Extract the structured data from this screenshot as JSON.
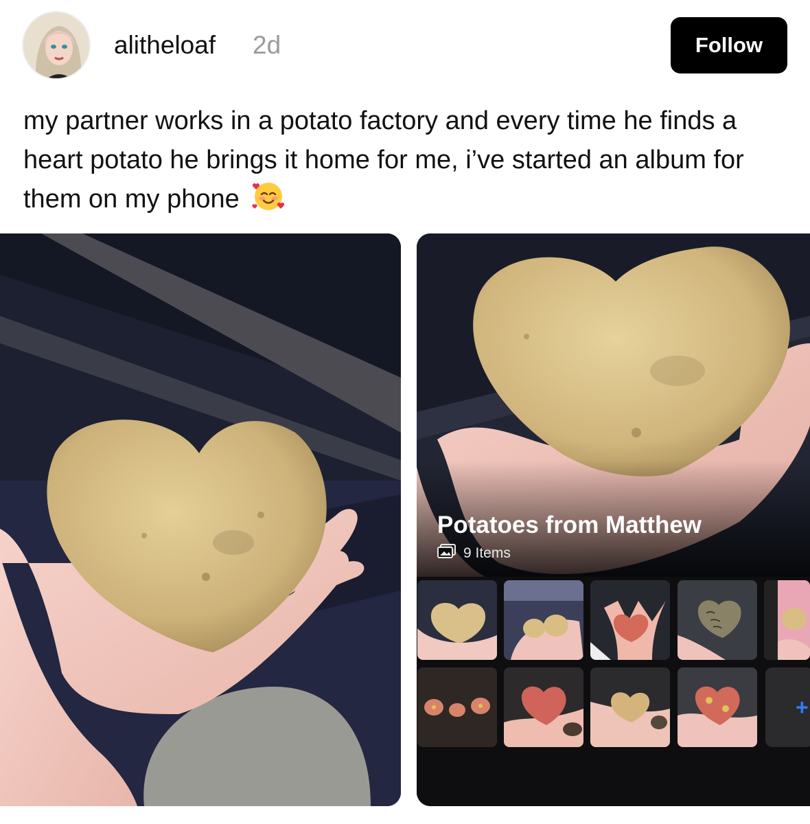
{
  "post": {
    "username": "alitheloaf",
    "timeago": "2d",
    "follow_label": "Follow",
    "caption": "my partner works in a potato factory and every time he finds a heart potato he brings it home for me, i’ve started an album for them on my phone",
    "caption_emoji_icon": "smiling-face-with-hearts-icon"
  },
  "album": {
    "title": "Potatoes from Matthew",
    "count": "9 Items",
    "count_icon": "photo-stack-icon",
    "add_label": "+"
  },
  "colors": {
    "follow_bg": "#000000",
    "timeago": "#9a9a9a",
    "potato": "#d8be82",
    "skin": "#f2c8c0",
    "add_blue": "#2f7cf6"
  }
}
